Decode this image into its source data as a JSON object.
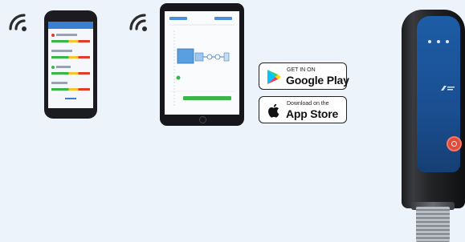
{
  "badges": {
    "google_play": {
      "small": "GET IN ON",
      "big": "Google Play"
    },
    "app_store": {
      "small": "Download on the",
      "big": "App Store"
    }
  },
  "colors": {
    "background": "#edf3fa",
    "device_blue": "#1d5ca6",
    "power_button": "#e44a3b",
    "gauge_green": "#39b54a",
    "gauge_yellow": "#f7c530",
    "gauge_red": "#e23a2c"
  },
  "icons": {
    "wifi": "wifi-icon",
    "google_play": "google-play-icon",
    "apple": "apple-icon",
    "power": "power-icon"
  }
}
